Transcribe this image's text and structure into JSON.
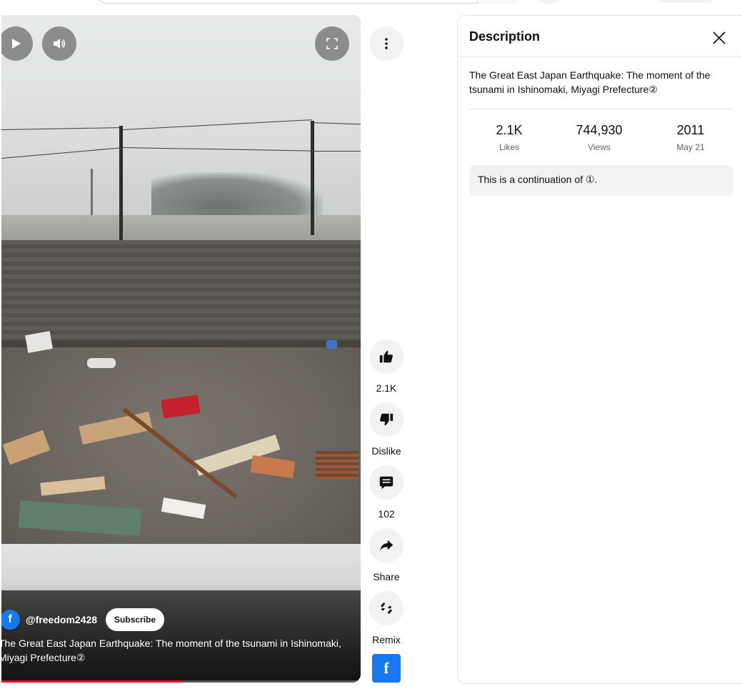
{
  "player": {
    "play_icon": "play-icon",
    "volume_icon": "volume-icon",
    "fullscreen_icon": "fullscreen-icon",
    "channel_initial": "f",
    "channel_name": "@freedom2428",
    "subscribe_label": "Subscribe",
    "title": "The Great East Japan Earthquake: The moment of the tsunami in Ishinomaki, Miyagi Prefecture②",
    "progress": 0.5
  },
  "actions": {
    "more_icon": "more-vert-icon",
    "like_label": "2.1K",
    "dislike_label": "Dislike",
    "comments_label": "102",
    "share_label": "Share",
    "remix_label": "Remix",
    "fb_letter": "f"
  },
  "description": {
    "heading": "Description",
    "close_icon": "close-icon",
    "title": "The Great East Japan Earthquake: The moment of the tsunami in Ishinomaki, Miyagi Prefecture②",
    "stats": [
      {
        "value": "2.1K",
        "label": "Likes"
      },
      {
        "value": "744,930",
        "label": "Views"
      },
      {
        "value": "2011",
        "label": "May 21"
      }
    ],
    "body": "This is a continuation of ①."
  },
  "colors": {
    "brand_red": "#ff0033",
    "facebook_blue": "#1877f2",
    "panel_border": "#e5e5e5",
    "chip_bg": "#f2f2f2"
  }
}
